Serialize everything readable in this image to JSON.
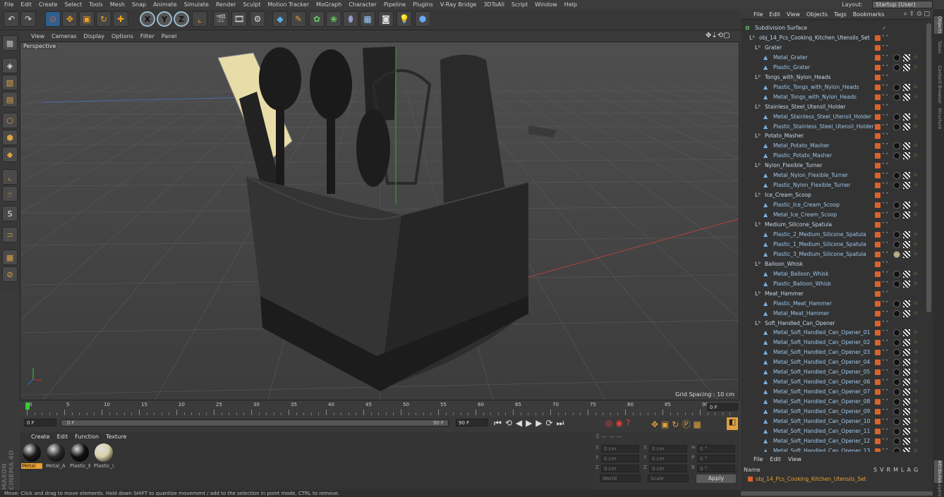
{
  "menubar": {
    "items": [
      "File",
      "Edit",
      "Create",
      "Select",
      "Tools",
      "Mesh",
      "Snap",
      "Animate",
      "Simulate",
      "Render",
      "Sculpt",
      "Motion Tracker",
      "MoGraph",
      "Character",
      "Pipeline",
      "Plugins",
      "V-Ray Bridge",
      "3DToAll",
      "Script",
      "Window",
      "Help"
    ],
    "layout_label": "Layout:",
    "layout_value": "Startup (User)"
  },
  "toolbar": {
    "axis_x": "X",
    "axis_y": "Y",
    "axis_z": "Z"
  },
  "viewport": {
    "menu": [
      "View",
      "Cameras",
      "Display",
      "Options",
      "Filter",
      "Panel"
    ],
    "label": "Perspective",
    "grid_spacing": "Grid Spacing : 10 cm"
  },
  "timeline": {
    "ticks": [
      "0",
      "5",
      "10",
      "15",
      "20",
      "25",
      "30",
      "35",
      "40",
      "45",
      "50",
      "55",
      "60",
      "65",
      "70",
      "75",
      "80",
      "85",
      "90"
    ],
    "current_frame": "0 F",
    "start": "0 F",
    "slider_start": "0 F",
    "slider_end": "90 F",
    "end": "90 F"
  },
  "materials": {
    "menu": [
      "Create",
      "Edit",
      "Function",
      "Texture"
    ],
    "items": [
      {
        "label": "Metal",
        "color": "#1a1a1a",
        "active": true
      },
      {
        "label": "Metal_A",
        "color": "#2a2a2a",
        "active": false
      },
      {
        "label": "Plastic_E",
        "color": "#111111",
        "active": false
      },
      {
        "label": "Plastic_\\",
        "color": "#d9d0a8",
        "active": false
      }
    ]
  },
  "coords": {
    "rows": [
      {
        "a": "X",
        "v1": "0 cm",
        "b": "X",
        "v2": "0 cm",
        "c": "H",
        "v3": "0 °"
      },
      {
        "a": "Y",
        "v1": "0 cm",
        "b": "Y",
        "v2": "0 cm",
        "c": "P",
        "v3": "0 °"
      },
      {
        "a": "Z",
        "v1": "0 cm",
        "b": "Z",
        "v2": "0 cm",
        "c": "B",
        "v3": "0 °"
      }
    ],
    "mode1": "World",
    "mode2": "Scale",
    "apply": "Apply"
  },
  "status": "Move: Click and drag to move elements. Hold down SHIFT to quantize movement / add to the selection in point mode, CTRL to remove.",
  "objects": {
    "menu": [
      "File",
      "Edit",
      "View",
      "Objects",
      "Tags",
      "Bookmarks"
    ],
    "rows": [
      {
        "name": "Subdivision Surface",
        "level": 0,
        "type": "sub"
      },
      {
        "name": "obj_14_Pcs_Cooking_Kitchen_Utensils_Set",
        "level": 1,
        "type": "grp"
      },
      {
        "name": "Grater",
        "level": 2,
        "type": "grp"
      },
      {
        "name": "Metal_Grater",
        "level": 3,
        "type": "obj",
        "mat": "black"
      },
      {
        "name": "Plastic_Grater",
        "level": 3,
        "type": "obj",
        "mat": "black"
      },
      {
        "name": "Tongs_with_Nylon_Heads",
        "level": 2,
        "type": "grp"
      },
      {
        "name": "Plastic_Tongs_with_Nylon_Heads",
        "level": 3,
        "type": "obj",
        "mat": "black"
      },
      {
        "name": "Metal_Tongs_with_Nylon_Heads",
        "level": 3,
        "type": "obj",
        "mat": "black"
      },
      {
        "name": "Stainless_Steel_Utensil_Holder",
        "level": 2,
        "type": "grp"
      },
      {
        "name": "Metal_Stainless_Steel_Utensil_Holder",
        "level": 3,
        "type": "obj",
        "mat": "black"
      },
      {
        "name": "Plastic_Stainless_Steel_Utensil_Holder",
        "level": 3,
        "type": "obj",
        "mat": "black"
      },
      {
        "name": "Potato_Masher",
        "level": 2,
        "type": "grp"
      },
      {
        "name": "Metal_Potato_Masher",
        "level": 3,
        "type": "obj",
        "mat": "black"
      },
      {
        "name": "Plastic_Potato_Masher",
        "level": 3,
        "type": "obj",
        "mat": "black"
      },
      {
        "name": "Nylon_Flexible_Turner",
        "level": 2,
        "type": "grp"
      },
      {
        "name": "Metal_Nylon_Flexible_Turner",
        "level": 3,
        "type": "obj",
        "mat": "black"
      },
      {
        "name": "Plastic_Nylon_Flexible_Turner",
        "level": 3,
        "type": "obj",
        "mat": "black"
      },
      {
        "name": "Ice_Cream_Scoop",
        "level": 2,
        "type": "grp"
      },
      {
        "name": "Plastic_Ice_Cream_Scoop",
        "level": 3,
        "type": "obj",
        "mat": "black"
      },
      {
        "name": "Metal_Ice_Cream_Scoop",
        "level": 3,
        "type": "obj",
        "mat": "black"
      },
      {
        "name": "Medium_Silicone_Spatula",
        "level": 2,
        "type": "grp"
      },
      {
        "name": "Plastic_2_Medium_Silicone_Spatula",
        "level": 3,
        "type": "obj",
        "mat": "black"
      },
      {
        "name": "Plastic_1_Medium_Silicone_Spatula",
        "level": 3,
        "type": "obj",
        "mat": "black"
      },
      {
        "name": "Plastic_3_Medium_Silicone_Spatula",
        "level": 3,
        "type": "obj",
        "mat": "cream"
      },
      {
        "name": "Balloon_Whisk",
        "level": 2,
        "type": "grp"
      },
      {
        "name": "Metal_Balloon_Whisk",
        "level": 3,
        "type": "obj",
        "mat": "black"
      },
      {
        "name": "Plastic_Balloon_Whisk",
        "level": 3,
        "type": "obj",
        "mat": "black"
      },
      {
        "name": "Meat_Hammer",
        "level": 2,
        "type": "grp"
      },
      {
        "name": "Plastic_Meat_Hammer",
        "level": 3,
        "type": "obj",
        "mat": "black"
      },
      {
        "name": "Metal_Meat_Hammer",
        "level": 3,
        "type": "obj",
        "mat": "black"
      },
      {
        "name": "Soft_Handled_Can_Opener",
        "level": 2,
        "type": "grp"
      },
      {
        "name": "Metal_Soft_Handled_Can_Opener_01",
        "level": 3,
        "type": "obj",
        "mat": "black"
      },
      {
        "name": "Metal_Soft_Handled_Can_Opener_02",
        "level": 3,
        "type": "obj",
        "mat": "black"
      },
      {
        "name": "Metal_Soft_Handled_Can_Opener_03",
        "level": 3,
        "type": "obj",
        "mat": "black"
      },
      {
        "name": "Metal_Soft_Handled_Can_Opener_04",
        "level": 3,
        "type": "obj",
        "mat": "black"
      },
      {
        "name": "Metal_Soft_Handled_Can_Opener_05",
        "level": 3,
        "type": "obj",
        "mat": "black"
      },
      {
        "name": "Metal_Soft_Handled_Can_Opener_06",
        "level": 3,
        "type": "obj",
        "mat": "black"
      },
      {
        "name": "Metal_Soft_Handled_Can_Opener_07",
        "level": 3,
        "type": "obj",
        "mat": "black"
      },
      {
        "name": "Metal_Soft_Handled_Can_Opener_08",
        "level": 3,
        "type": "obj",
        "mat": "black"
      },
      {
        "name": "Metal_Soft_Handled_Can_Opener_09",
        "level": 3,
        "type": "obj",
        "mat": "black"
      },
      {
        "name": "Metal_Soft_Handled_Can_Opener_10",
        "level": 3,
        "type": "obj",
        "mat": "black"
      },
      {
        "name": "Metal_Soft_Handled_Can_Opener_11",
        "level": 3,
        "type": "obj",
        "mat": "black"
      },
      {
        "name": "Metal_Soft_Handled_Can_Opener_12",
        "level": 3,
        "type": "obj",
        "mat": "black"
      },
      {
        "name": "Metal_Soft_Handled_Can_Opener_13",
        "level": 3,
        "type": "obj",
        "mat": "black"
      }
    ]
  },
  "attributes": {
    "menu": [
      "File",
      "Edit",
      "View"
    ],
    "col_name": "Name",
    "cols": [
      "S",
      "V",
      "R",
      "M",
      "L",
      "A",
      "G"
    ],
    "row": "obj_14_Pcs_Cooking_Kitchen_Utensils_Set"
  },
  "sidetabs": [
    "Objects",
    "Takes",
    "Content Browser",
    "Structure",
    "Attributes",
    "Layers"
  ],
  "brand": "MAXON CINEMA 4D"
}
